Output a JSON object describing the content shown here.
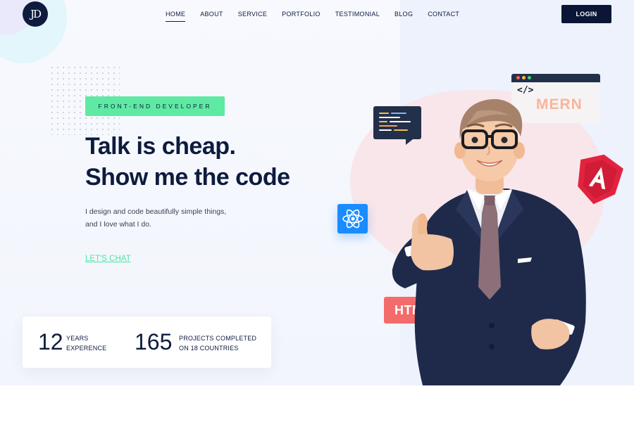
{
  "brand": {
    "logo_text": "JD"
  },
  "nav": {
    "items": [
      {
        "label": "HOME",
        "active": true
      },
      {
        "label": "ABOUT"
      },
      {
        "label": "SERVICE"
      },
      {
        "label": "PORTFOLIO"
      },
      {
        "label": "TESTIMONIAL"
      },
      {
        "label": "BLOG"
      },
      {
        "label": "CONTACT"
      }
    ],
    "login_label": "LOGIN"
  },
  "hero": {
    "badge": "FRONT-END DEVELOPER",
    "headline_line1": "Talk is cheap.",
    "headline_line2": "Show me the code",
    "description_line1": "I design and code beautifully simple things,",
    "description_line2": "and I love what I do.",
    "cta": "LET'S CHAT"
  },
  "stats": {
    "experience": {
      "number": "12",
      "label_line1": "YEARS",
      "label_line2": "EXPERENCE"
    },
    "projects": {
      "number": "165",
      "label_line1": "PROJECTS COMPLETED",
      "label_line2": "ON 18 COUNTRIES"
    }
  },
  "floating": {
    "mern_code": "</>",
    "mern_label": "MERN",
    "html_label": "HTML",
    "icons": [
      "code-chat-icon",
      "mern-window-icon",
      "angular-icon",
      "react-icon",
      "html-tag-icon"
    ]
  },
  "colors": {
    "navy": "#0d1b3e",
    "accent_green": "#5eeaa3",
    "link_green": "#4fe3a0",
    "react_blue": "#1a8cff",
    "angular_red": "#e2233f",
    "html_red": "#f36b6b"
  }
}
